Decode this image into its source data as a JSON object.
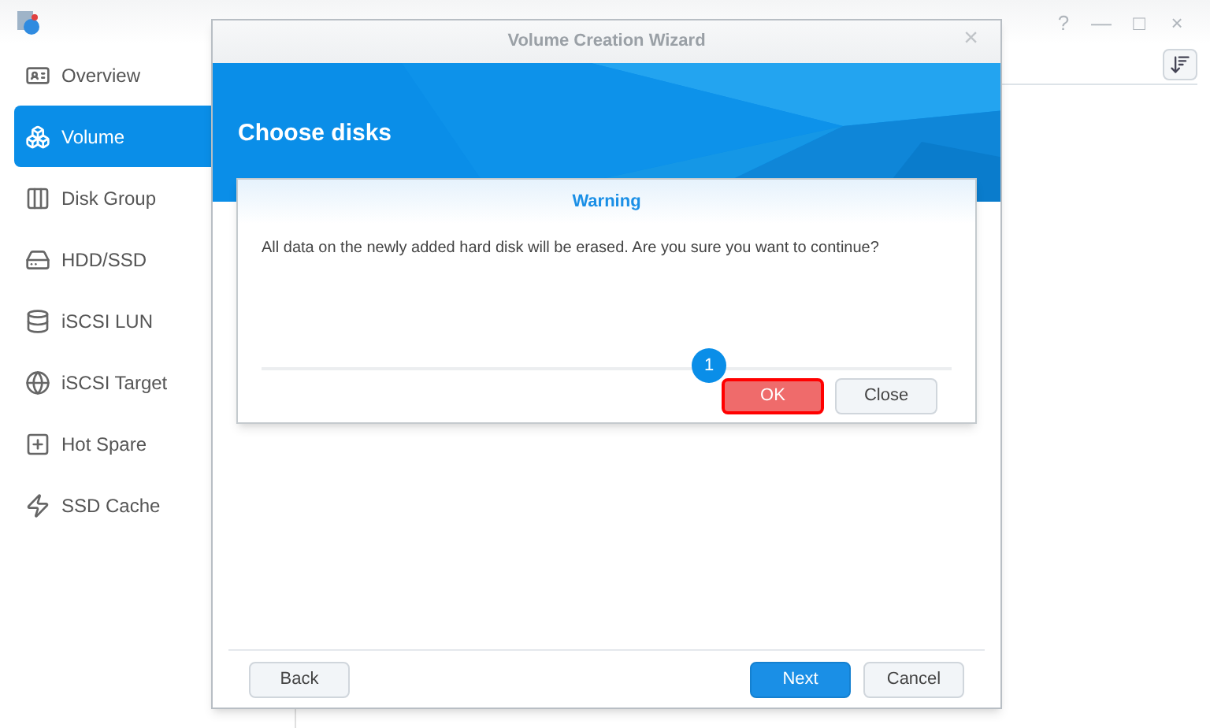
{
  "window": {
    "controls": [
      "?",
      "—",
      "□",
      "×"
    ]
  },
  "sidebar": {
    "items": [
      {
        "label": "Overview",
        "selected": false
      },
      {
        "label": "Volume",
        "selected": true
      },
      {
        "label": "Disk Group",
        "selected": false
      },
      {
        "label": "HDD/SSD",
        "selected": false
      },
      {
        "label": "iSCSI LUN",
        "selected": false
      },
      {
        "label": "iSCSI Target",
        "selected": false
      },
      {
        "label": "Hot Spare",
        "selected": false
      },
      {
        "label": "SSD Cache",
        "selected": false
      }
    ]
  },
  "wizard": {
    "title": "Volume Creation Wizard",
    "close": "×",
    "heading": "Choose disks",
    "footer_buttons": [
      {
        "label": "Back",
        "primary": false
      },
      {
        "label": "Next",
        "primary": true
      },
      {
        "label": "Cancel",
        "primary": false
      }
    ]
  },
  "warning_dialog": {
    "title": "Warning",
    "message": "All data on the newly added hard disk will be erased. Are you sure you want to continue?",
    "step_badge": "1",
    "buttons": [
      {
        "label": "OK",
        "highlighted": true
      },
      {
        "label": "Close",
        "highlighted": false
      }
    ]
  }
}
